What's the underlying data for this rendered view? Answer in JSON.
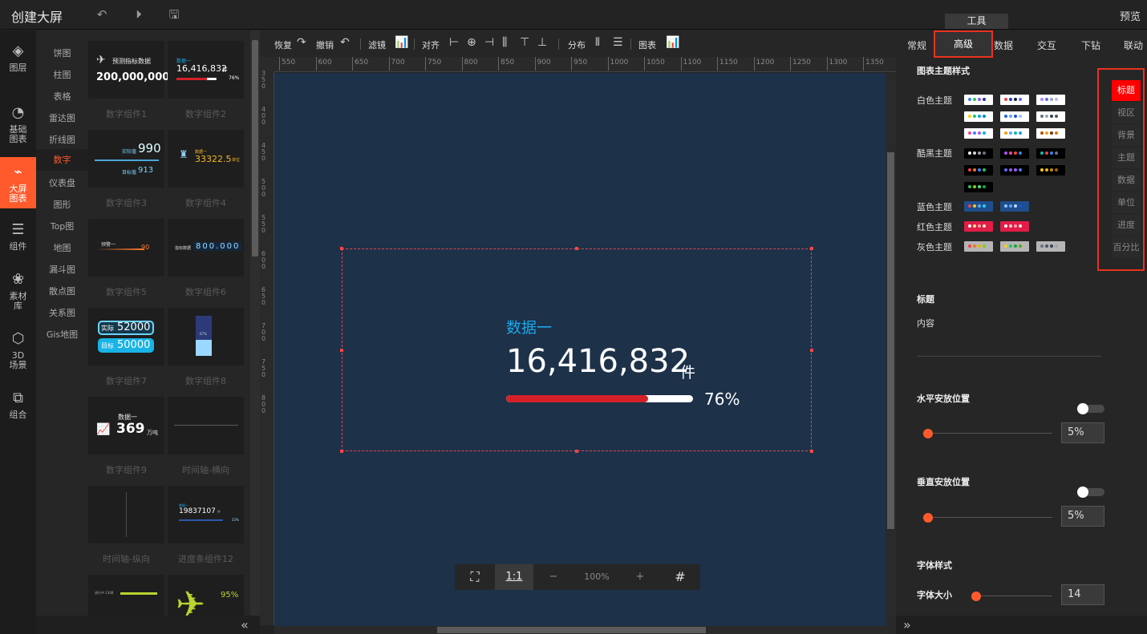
{
  "app": {
    "title": "创建大屏",
    "preview": "预览",
    "tools_tab": "工具"
  },
  "topbar_icons": [
    "undo-icon",
    "play-icon",
    "save-icon"
  ],
  "nav": [
    {
      "label1": "图层",
      "label2": "",
      "icon": "layers-icon"
    },
    {
      "label1": "基础",
      "label2": "图表",
      "icon": "chart-clock-icon"
    },
    {
      "label1": "大屏",
      "label2": "图表",
      "icon": "bigscreen-icon"
    },
    {
      "label1": "组件",
      "label2": "",
      "icon": "sliders-icon"
    },
    {
      "label1": "素材",
      "label2": "库",
      "icon": "material-icon"
    },
    {
      "label1": "3D",
      "label2": "场景",
      "icon": "cube-icon"
    },
    {
      "label1": "组合",
      "label2": "",
      "icon": "group-icon"
    }
  ],
  "categories": [
    "饼图",
    "柱图",
    "表格",
    "雷达图",
    "折线图",
    "数字",
    "仪表盘",
    "图形",
    "Top图",
    "地图",
    "漏斗图",
    "散点图",
    "关系图",
    "Gis地图"
  ],
  "thumbs": [
    {
      "label": "数字组件1",
      "t1": "预测指标数据",
      "t2": "200,000,000"
    },
    {
      "label": "数字组件2",
      "t1": "数据一",
      "t2": "16,416,832",
      "t3": "件",
      "t4": "76%"
    },
    {
      "label": "数字组件3",
      "t1": "实际值",
      "t2": "990",
      "t3": "目标值",
      "t4": "913"
    },
    {
      "label": "数字组件4",
      "t1": "数据一",
      "t2": "33322.5",
      "t3": "单位"
    },
    {
      "label": "数字组件5",
      "t1": "预警一",
      "t2": "90"
    },
    {
      "label": "数字组件6",
      "t1": "指标数据",
      "t2": "800.000"
    },
    {
      "label": "数字组件7",
      "t1": "实际",
      "t2": "52000",
      "t3": "目标",
      "t4": "50000"
    },
    {
      "label": "数字组件8",
      "t1": "67%"
    },
    {
      "label": "数字组件9",
      "t1": "数据一",
      "t2": "369",
      "t3": "万吨"
    },
    {
      "label": "时间轴-横向"
    },
    {
      "label": "时间轴-纵向"
    },
    {
      "label": "进度条组件12",
      "t1": "数据一",
      "t2": "19837107",
      "t3": "件",
      "t4": "53%"
    },
    {
      "label": "",
      "t1": "进行中 1308"
    },
    {
      "label": "",
      "t1": "95%"
    }
  ],
  "toolbar": {
    "redo": "恢复",
    "undo": "撤销",
    "filter": "滤镜",
    "align": "对齐",
    "distribute": "分布",
    "chart": "图表"
  },
  "ruler_top": [
    "550",
    "600",
    "650",
    "700",
    "750",
    "800",
    "850",
    "900",
    "950",
    "1000",
    "1050",
    "1100",
    "1150",
    "1200",
    "1250",
    "1300",
    "1350"
  ],
  "ruler_left": [
    "3 5 0",
    "4 0 0",
    "4 5 0",
    "5 0 0",
    "5 5 0",
    "6 0 0",
    "6 5 0",
    "7 0 0",
    "7 5 0",
    "8 0 0"
  ],
  "widget": {
    "title": "数据一",
    "value": "16,416,832",
    "unit": "件",
    "percent": "76%",
    "progress": 0.76,
    "title_color": "#1aa7e8",
    "bar_color": "#d42028"
  },
  "zoom": {
    "fit_icon": "fit-screen-icon",
    "one_to_one": "1:1",
    "minus": "−",
    "level": "100%",
    "plus": "+",
    "grid_icon": "grid-icon"
  },
  "right_tabs": [
    "常规",
    "高级",
    "数据",
    "交互",
    "下钻",
    "联动"
  ],
  "right": {
    "section_title": "图表主题样式",
    "themes": [
      {
        "name": "白色主题"
      },
      {
        "name": "酷黑主题"
      },
      {
        "name": "蓝色主题"
      },
      {
        "name": "红色主题"
      },
      {
        "name": "灰色主题"
      }
    ],
    "side_tabs": [
      "标题",
      "视区",
      "背景",
      "主题",
      "数据",
      "单位",
      "进度",
      "百分比"
    ],
    "title_label": "标题",
    "content_label": "内容",
    "h_pos_label": "水平安放位置",
    "h_pos_value": "5%",
    "v_pos_label": "垂直安放位置",
    "v_pos_value": "5%",
    "font_style_label": "字体样式",
    "font_size_label": "字体大小",
    "font_size_value": "14"
  }
}
